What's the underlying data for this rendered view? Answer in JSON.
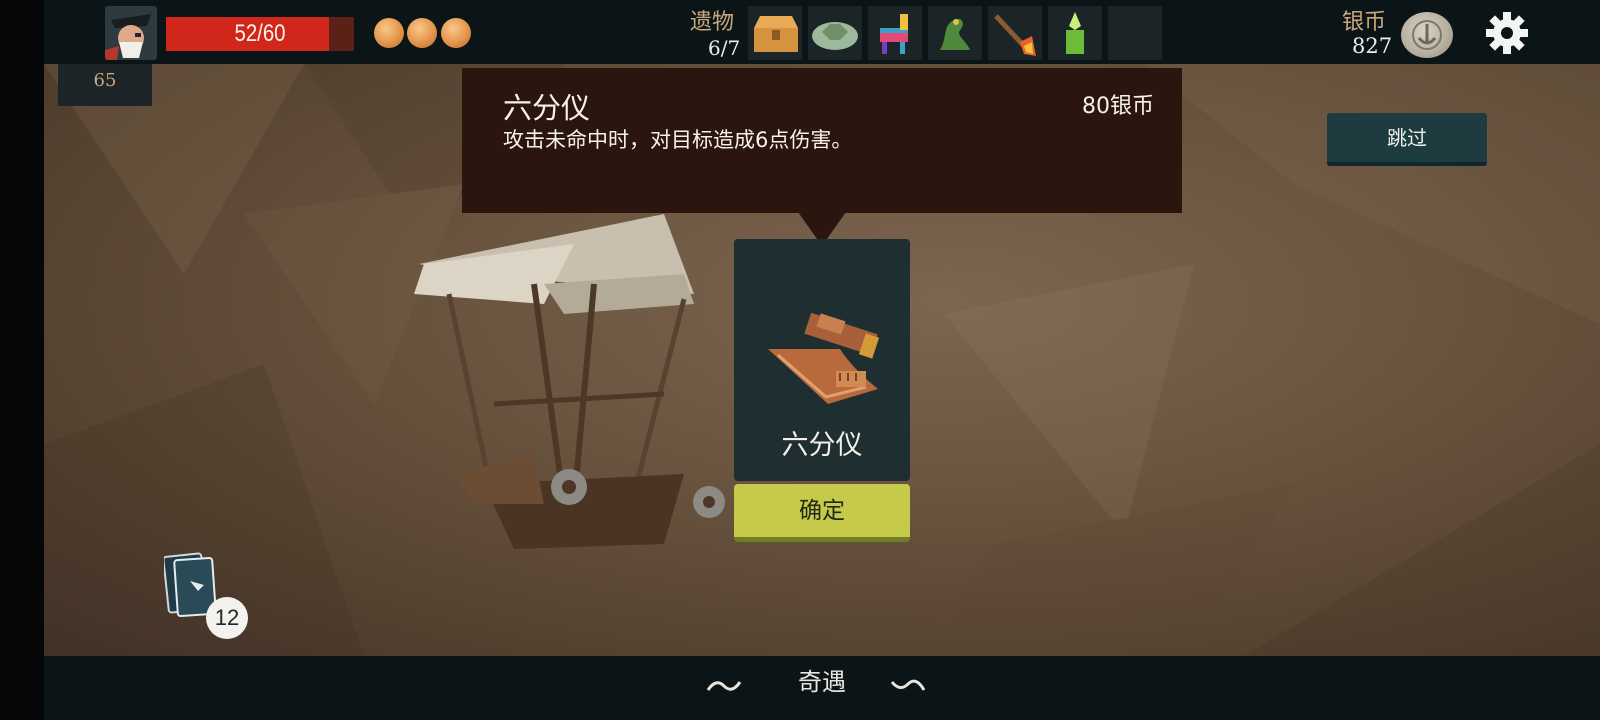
{
  "player": {
    "hp_text": "52/60",
    "hp_fraction": 0.867,
    "energy_orbs": 3,
    "level": "65"
  },
  "relics": {
    "label": "遗物",
    "count": "6/7",
    "items": [
      {
        "icon": "treasure-chest-icon"
      },
      {
        "icon": "turtle-shell-icon"
      },
      {
        "icon": "pinata-icon"
      },
      {
        "icon": "green-dragon-icon"
      },
      {
        "icon": "torch-icon"
      },
      {
        "icon": "green-candle-icon"
      },
      {
        "icon": "empty-slot"
      }
    ]
  },
  "currency": {
    "label": "银币",
    "amount": "827",
    "icon": "silver-coin-icon"
  },
  "tooltip": {
    "name": "六分仪",
    "price": "80银币",
    "description": "攻击未命中时，对目标造成6点伤害。"
  },
  "skip_label": "跳过",
  "card": {
    "name": "六分仪",
    "icon": "sextant-icon"
  },
  "confirm_label": "确定",
  "deck": {
    "count": "12"
  },
  "footer": {
    "title": "奇遇"
  },
  "colors": {
    "hp_red": "#d1261a",
    "confirm_yellow": "#c6ca4a",
    "panel_teal": "#1e3b40",
    "bar_dark": "#0b1518",
    "tooltip_brown": "#2b160f",
    "label_tan": "#c9a67c"
  }
}
